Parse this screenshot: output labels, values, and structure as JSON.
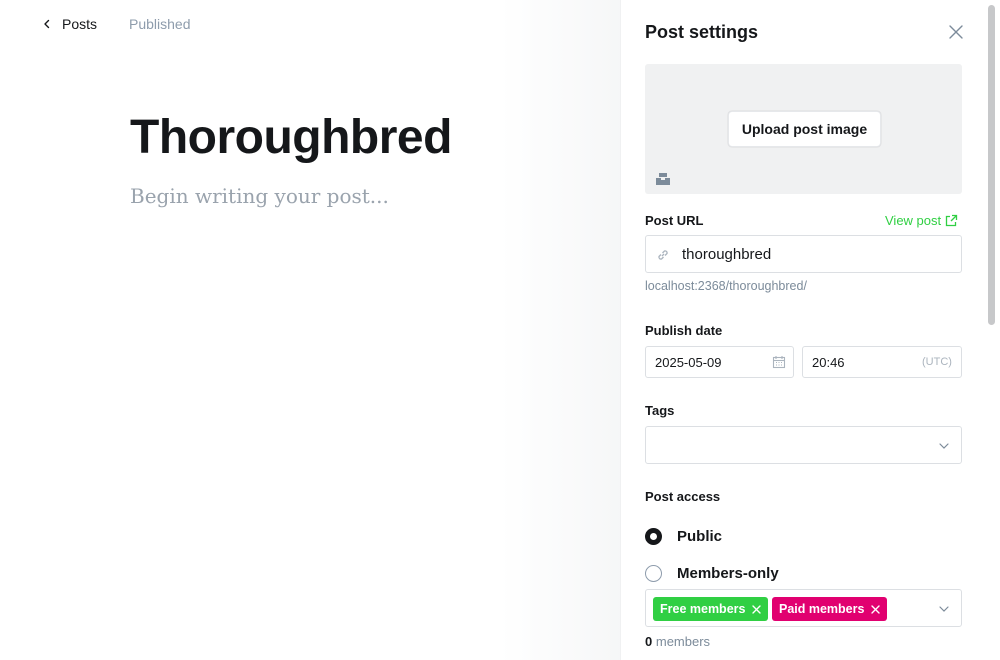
{
  "topbar": {
    "back_label": "Posts",
    "status": "Published"
  },
  "editor": {
    "title": "Thoroughbred",
    "body_placeholder": "Begin writing your post..."
  },
  "settings": {
    "title": "Post settings",
    "upload_label": "Upload post image",
    "url_label": "Post URL",
    "view_post_label": "View post",
    "slug": "thoroughbred",
    "url_preview": "localhost:2368/thoroughbred/",
    "publish_date_label": "Publish date",
    "date_value": "2025-05-09",
    "time_value": "20:46",
    "timezone": "(UTC)",
    "tags_label": "Tags",
    "access_label": "Post access",
    "access_options": [
      {
        "label": "Public",
        "checked": true
      },
      {
        "label": "Members-only",
        "checked": false
      }
    ],
    "tiers": [
      {
        "label": "Free members",
        "color": "#30cf43"
      },
      {
        "label": "Paid members",
        "color": "#e10070"
      }
    ],
    "member_count": "0",
    "member_count_suffix": "members"
  },
  "icons": {
    "back": "chevron-left-icon",
    "close": "close-icon",
    "unsplash": "unsplash-icon",
    "external": "external-link-icon",
    "link": "link-icon",
    "calendar": "calendar-icon",
    "dropdown": "chevron-down-icon",
    "remove": "remove-x-icon"
  },
  "colors": {
    "accent_green": "#30cf43",
    "accent_pink": "#e10070"
  }
}
